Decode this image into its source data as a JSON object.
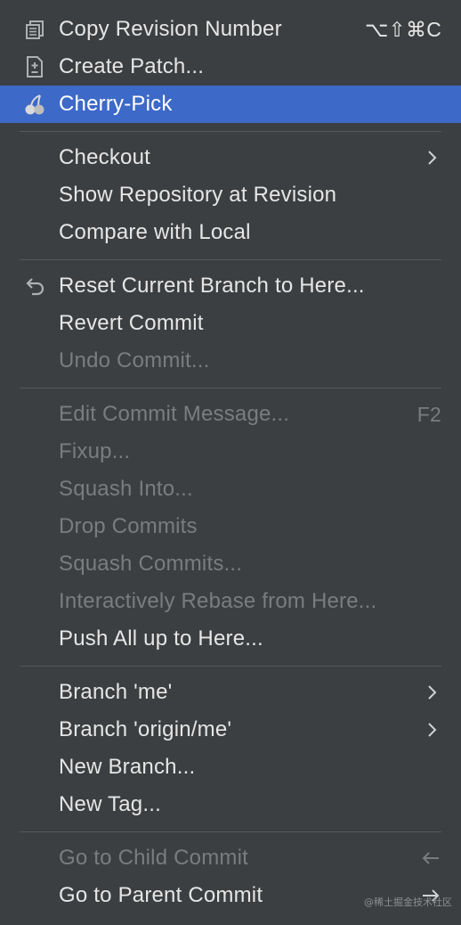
{
  "menu": {
    "groups": [
      {
        "items": [
          {
            "label": "Copy Revision Number",
            "shortcut": "⌥⇧⌘C",
            "icon": "copy-icon"
          },
          {
            "label": "Create Patch...",
            "icon": "patch-icon"
          },
          {
            "label": "Cherry-Pick",
            "icon": "cherry-icon",
            "selected": true
          }
        ]
      },
      {
        "items": [
          {
            "label": "Checkout",
            "submenu": true
          },
          {
            "label": "Show Repository at Revision"
          },
          {
            "label": "Compare with Local"
          }
        ]
      },
      {
        "items": [
          {
            "label": "Reset Current Branch to Here...",
            "icon": "undo-icon"
          },
          {
            "label": "Revert Commit"
          },
          {
            "label": "Undo Commit...",
            "disabled": true
          }
        ]
      },
      {
        "items": [
          {
            "label": "Edit Commit Message...",
            "shortcut": "F2",
            "disabled": true
          },
          {
            "label": "Fixup...",
            "disabled": true
          },
          {
            "label": "Squash Into...",
            "disabled": true
          },
          {
            "label": "Drop Commits",
            "disabled": true
          },
          {
            "label": "Squash Commits...",
            "disabled": true
          },
          {
            "label": "Interactively Rebase from Here...",
            "disabled": true
          },
          {
            "label": "Push All up to Here..."
          }
        ]
      },
      {
        "items": [
          {
            "label": "Branch 'me'",
            "submenu": true
          },
          {
            "label": "Branch 'origin/me'",
            "submenu": true
          },
          {
            "label": "New Branch..."
          },
          {
            "label": "New Tag..."
          }
        ]
      },
      {
        "items": [
          {
            "label": "Go to Child Commit",
            "arrow": "←",
            "disabled": true
          },
          {
            "label": "Go to Parent Commit",
            "arrow": "→"
          }
        ]
      }
    ]
  },
  "watermark": "@稀土掘金技术社区",
  "colors": {
    "background": "#3c3f41",
    "selection": "#3d69c8",
    "text": "#e6e6e6",
    "disabled_text": "#7a7d80",
    "separator": "#55585b"
  }
}
